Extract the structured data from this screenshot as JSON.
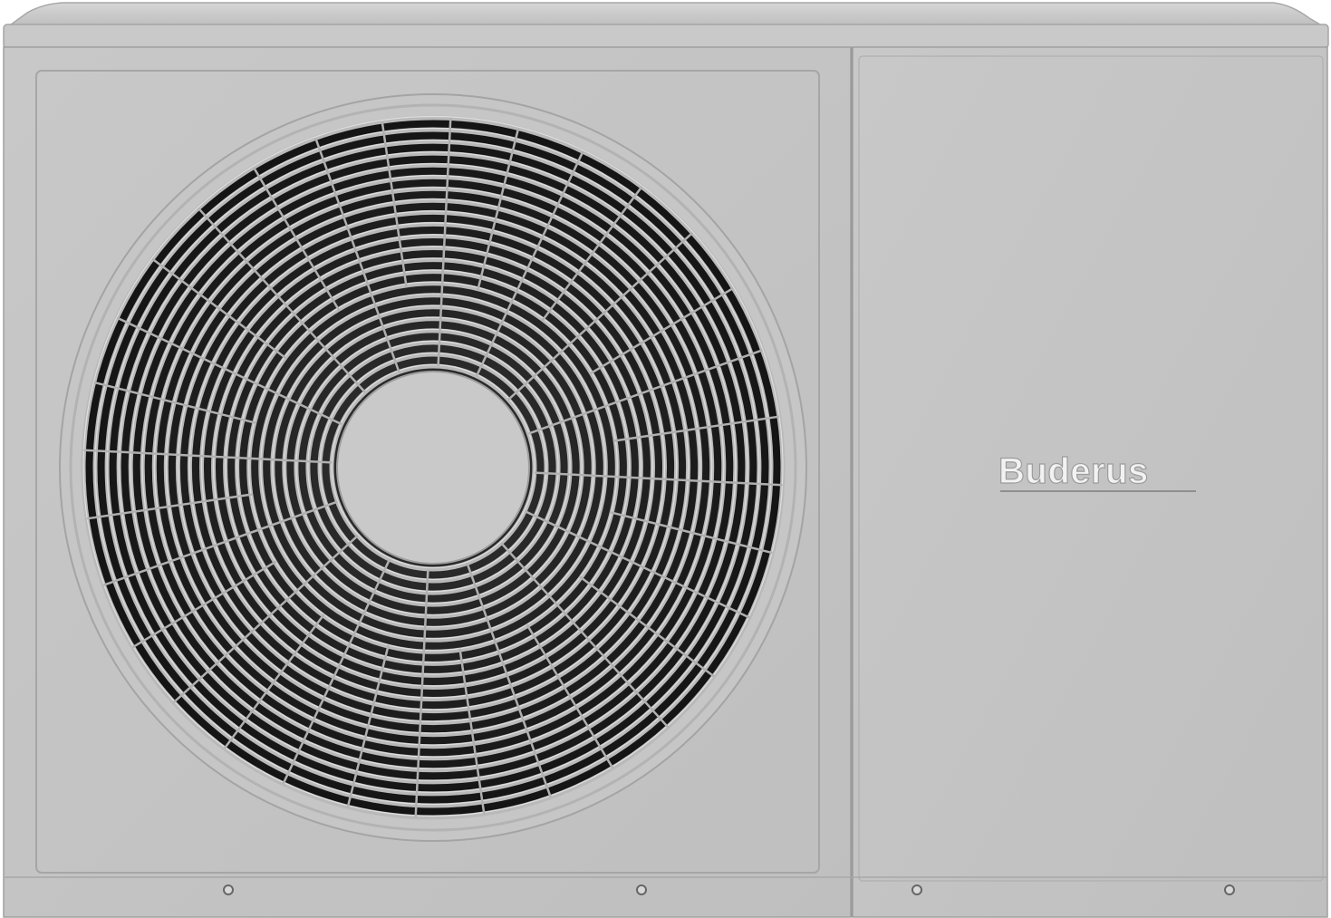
{
  "product": {
    "brand_label": "Buderus"
  },
  "colors": {
    "housing": "#c4c4c4",
    "housing_edge": "#a9a9a9",
    "top_lid": "#cfcfcf",
    "fan_dark": "#1e1e1e",
    "grille": "#b8b8b8",
    "hub": "#c9c9c9",
    "screw": "#6a6a6a"
  },
  "icons": {
    "fan": "fan-grille-icon",
    "screws": "screw-icon"
  }
}
